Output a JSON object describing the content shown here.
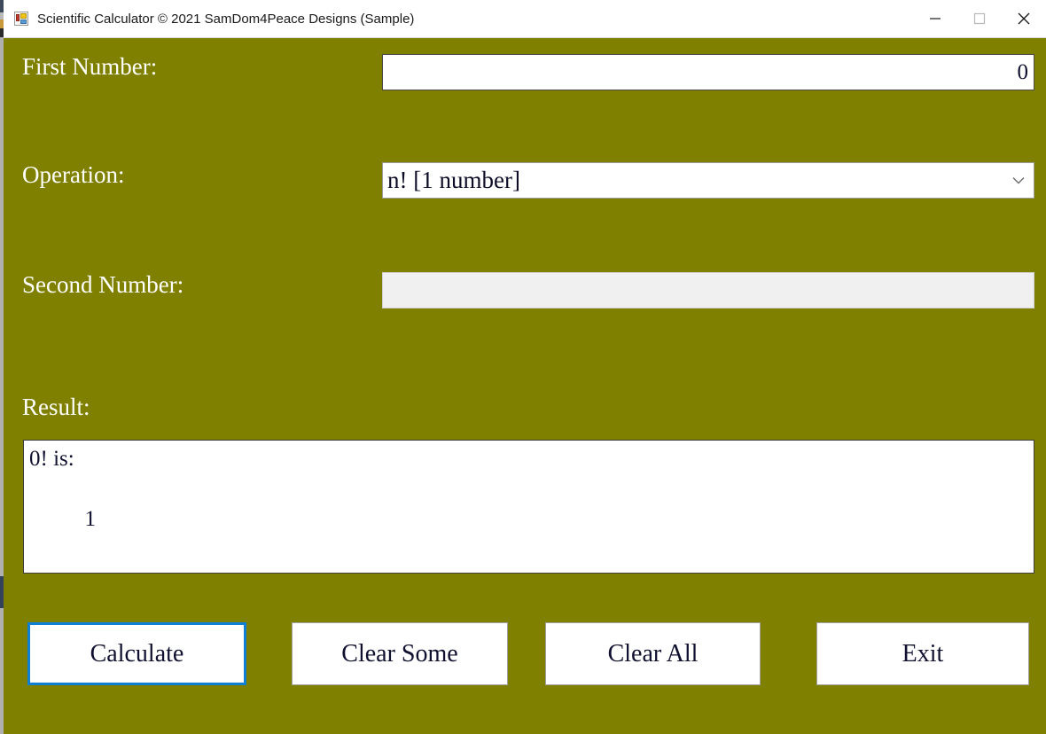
{
  "window": {
    "title": "Scientific Calculator © 2021 SamDom4Peace Designs (Sample)",
    "icon": "winforms-app-icon",
    "background_color": "#808000",
    "titlebar_color": "#ffffff",
    "controls": {
      "minimize": "minimize-icon",
      "maximize": "maximize-icon",
      "close": "close-icon"
    }
  },
  "form": {
    "first_number": {
      "label": "First Number:",
      "value": "0",
      "placeholder": ""
    },
    "operation": {
      "label": "Operation:",
      "selected": "n! [1 number]",
      "chevron": "chevron-down-icon"
    },
    "second_number": {
      "label": "Second Number:",
      "value": "",
      "placeholder": "",
      "disabled": true
    },
    "result": {
      "label": "Result:",
      "text": "0! is:\n\n          1"
    }
  },
  "buttons": {
    "calculate": "Calculate",
    "clear_some": "Clear Some",
    "clear_all": "Clear All",
    "exit": "Exit",
    "focus_color": "#0f7fd4"
  }
}
